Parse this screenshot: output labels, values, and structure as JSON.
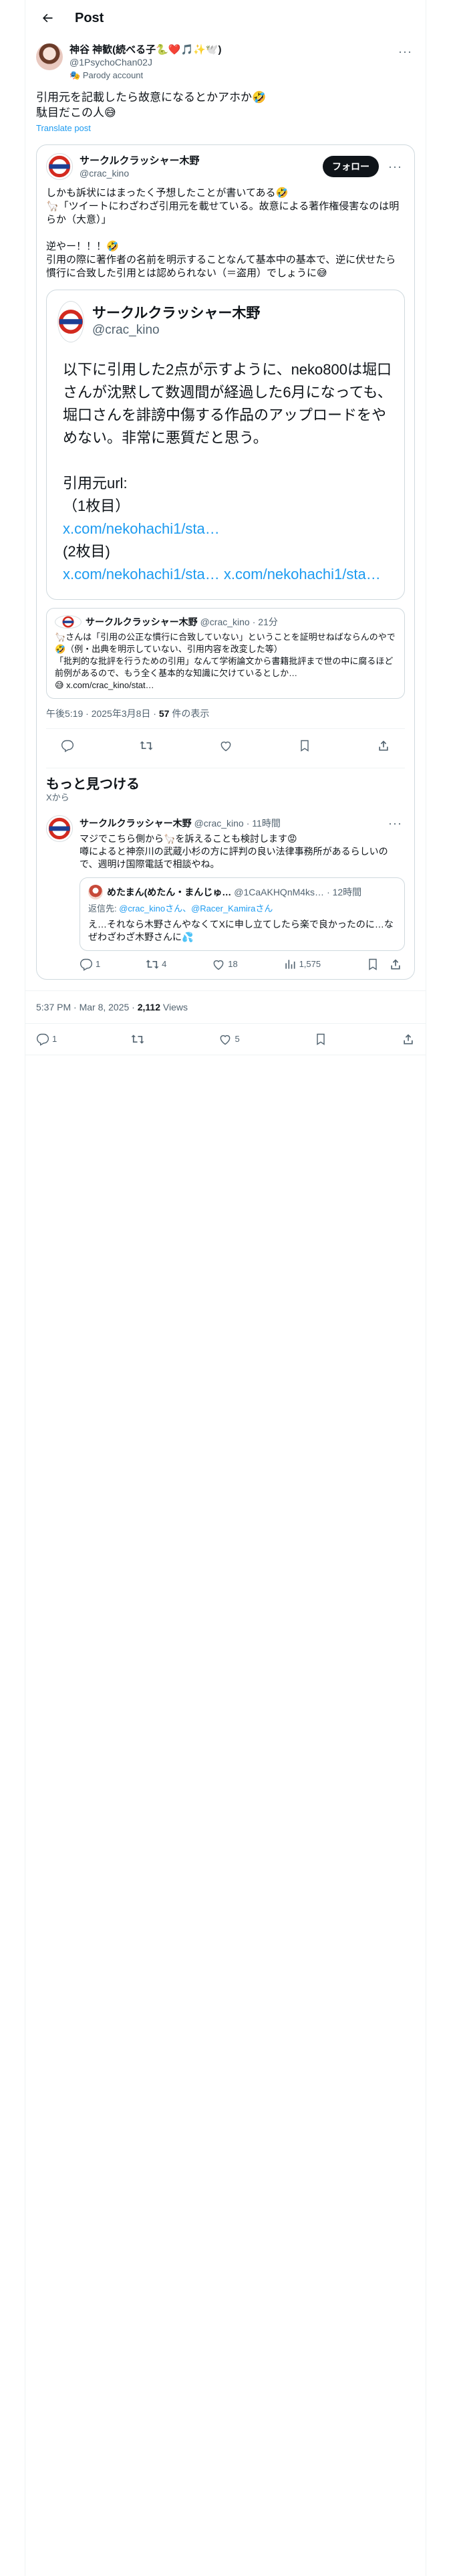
{
  "header": {
    "title": "Post"
  },
  "main_post": {
    "display_name": "神谷 神歓(続べる子🐍❤️🎵✨🕊️)",
    "handle": "@1PsychoChan02J",
    "parody_label": "Parody account",
    "text": "引用元を記載したら故意になるとかアホか🤣\n駄目だこの人😅",
    "translate": "Translate post",
    "timestamp": "5:37 PM · Mar 8, 2025 · ",
    "views_count": "2,112",
    "views_label": " Views"
  },
  "quote": {
    "display_name": "サークルクラッシャー木野",
    "handle": "@crac_kino",
    "follow_label": "フォロー",
    "text": "しかも訴状にはまったく予想したことが書いてある🤣\n🦙「ツイートにわざわざ引用元を載せている。故意による著作権侵害なのは明らか（大意）」\n\n逆やー！！！🤣\n引用の際に著作者の名前を明示することなんて基本中の基本で、逆に伏せたら慣行に合致した引用とは認められない（＝盗用）でしょうに😅",
    "inner_quote": {
      "display_name": "サークルクラッシャー木野",
      "handle": "@crac_kino",
      "text": "以下に引用した2点が示すように、neko800は堀口さんが沈黙して数週間が経過した6月になっても、堀口さんを誹謗中傷する作品のアップロードをやめない。非常に悪質だと思う。\n\n引用元url:\n（1枚目）",
      "link1": "x.com/nekohachi1/sta…",
      "label2": "(2枚目)",
      "link2": "x.com/nekohachi1/sta…",
      "link3": "x.com/nekohachi1/sta…"
    },
    "small_quote": {
      "display_name": "サークルクラッシャー木野",
      "handle": "@crac_kino",
      "time": "· 21分",
      "text": "🦙さんは「引用の公正な慣行に合致していない」ということを証明せねばならんのやで🤣（例・出典を明示していない、引用内容を改変した等）\n「批判的な批評を行うための引用」なんて学術論文から書籍批評まで世の中に腐るほど前例があるので、もう全く基本的な知識に欠けているとしか…\n😅 x.com/crac_kino/stat…"
    },
    "timestamp": "午後5:19 · 2025年3月8日 · ",
    "views_count": "57",
    "views_label": " 件の表示"
  },
  "more": {
    "title": "もっと見つける",
    "subtitle": "Xから",
    "reply": {
      "display_name": "サークルクラッシャー木野",
      "handle": "@crac_kino",
      "time": "· 11時間",
      "text": "マジでこちら側から🦙を訴えることも検討します😡\n噂によると神奈川の武蔵小杉の方に評判の良い法律事務所があるらしいので、週明け国際電話で相談やね。",
      "nested": {
        "display_name": "めたまん(めたん・まんじゅ…",
        "handle": "@1CaAKHQnM4ks…",
        "time": "· 12時間",
        "replying_prefix": "返信先: ",
        "replying_to": "@crac_kinoさん、@Racer_Kamiraさん",
        "text": "え…それなら木野さんやなくてXに申し立てしたら楽で良かったのに…なぜわざわざ木野さんに💦"
      },
      "counts": {
        "replies": "1",
        "reposts": "4",
        "likes": "18",
        "views": "1,575"
      }
    }
  },
  "bottom_counts": {
    "replies": "1",
    "likes": "5"
  }
}
